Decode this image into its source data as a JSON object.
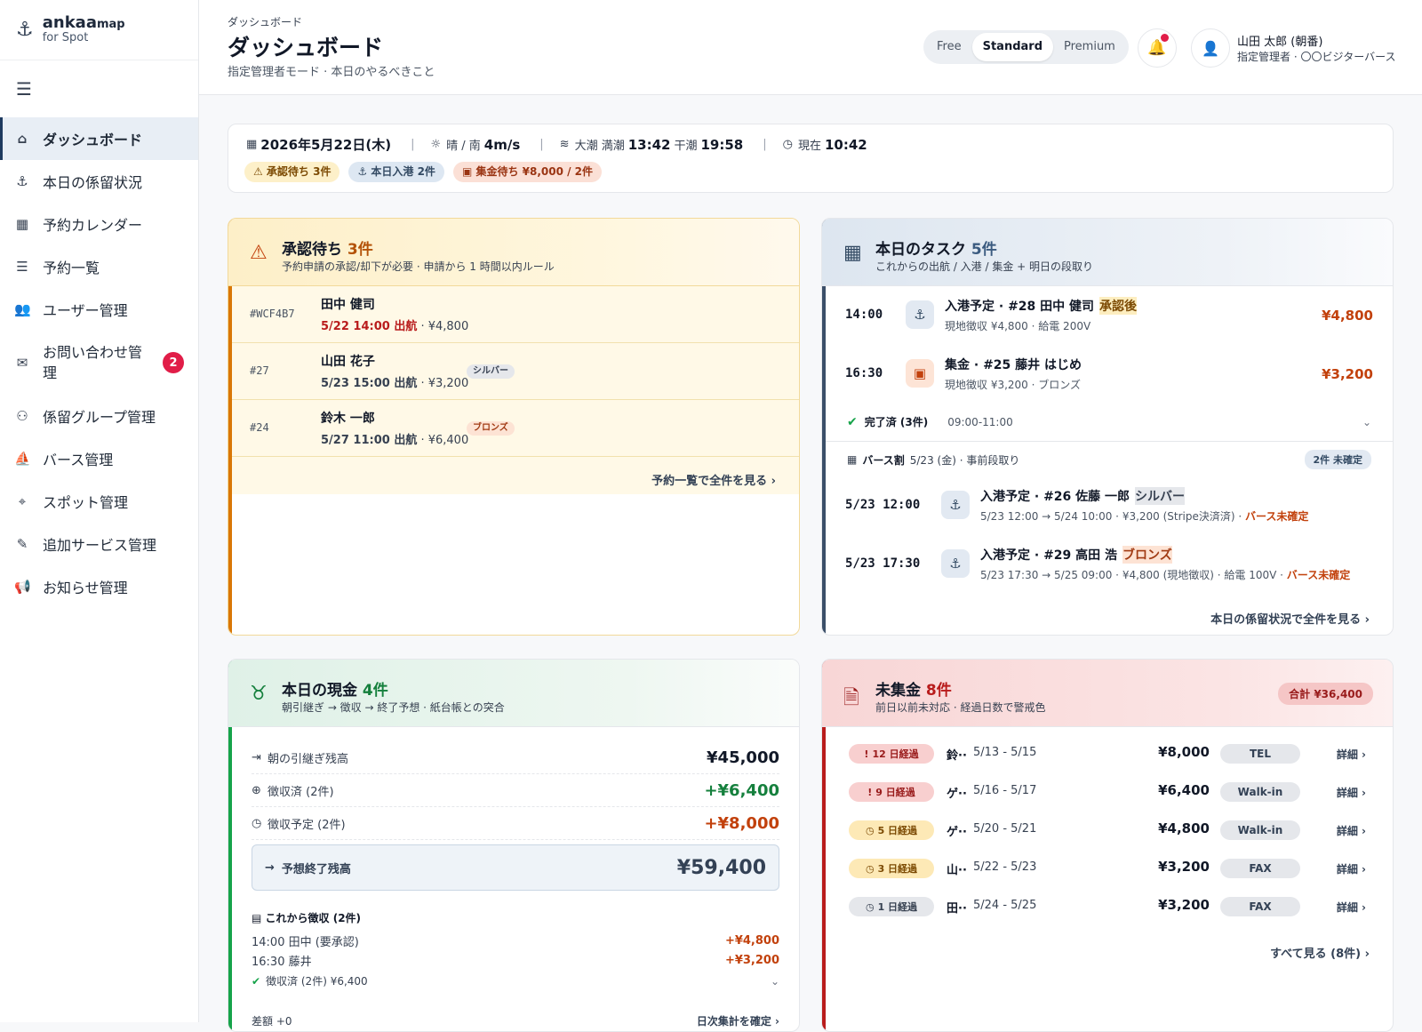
{
  "brand": {
    "name": "ankaa",
    "suffix": "map",
    "sub": "for Spot"
  },
  "nav": [
    {
      "label": "ダッシュボード",
      "icon": "home-icon",
      "glyph": "⌂",
      "active": true
    },
    {
      "label": "本日の係留状況",
      "icon": "anchor-icon",
      "glyph": "⚓"
    },
    {
      "label": "予約カレンダー",
      "icon": "calendar-icon",
      "glyph": "▦"
    },
    {
      "label": "予約一覧",
      "icon": "list-icon",
      "glyph": "☰"
    },
    {
      "label": "ユーザー管理",
      "icon": "users-icon",
      "glyph": "👥"
    },
    {
      "label": "お問い合わせ管理",
      "icon": "chat-icon",
      "glyph": "✉",
      "badge": "2"
    },
    {
      "label": "係留グループ管理",
      "icon": "group-icon",
      "glyph": "⚇"
    },
    {
      "label": "バース管理",
      "icon": "boat-icon",
      "glyph": "⛵"
    },
    {
      "label": "スポット管理",
      "icon": "pin-icon",
      "glyph": "⌖"
    },
    {
      "label": "追加サービス管理",
      "icon": "service-icon",
      "glyph": "✎"
    },
    {
      "label": "お知らせ管理",
      "icon": "megaphone-icon",
      "glyph": "📢"
    }
  ],
  "header": {
    "breadcrumb": "ダッシュボード",
    "title": "ダッシュボード",
    "subtitle": "指定管理者モード · 本日のやるべきこと",
    "plans": [
      "Free",
      "Standard",
      "Premium"
    ],
    "active_plan": "Standard",
    "user_name": "山田 太郎 (朝番)",
    "user_role": "指定管理者 · 〇〇ビジターバース"
  },
  "info": {
    "date": "2026年5月22日(木)",
    "weather_label": "晴 / 南",
    "wind": "4m/s",
    "tide_label": "大潮 満潮",
    "high_tide": "13:42",
    "low_label": "干潮",
    "low_tide": "19:58",
    "now_label": "現在",
    "now": "10:42",
    "chips": [
      "⚠ 承認待ち 3件",
      "⚓ 本日入港 2件",
      "▣ 集金待ち ¥8,000 / 2件"
    ]
  },
  "approvals": {
    "title": "承認待ち",
    "count": "3件",
    "subtitle": "予約申請の承認/却下が必要 · 申請から 1 時間以内ルール",
    "rows": [
      {
        "id": "#WCF4B7",
        "name": "田中 健司",
        "when": "5/22 14:00 出航",
        "price": " · ¥4,800",
        "tag": ""
      },
      {
        "id": "#27",
        "name": "山田 花子",
        "when": "5/23 15:00 出航",
        "price": " · ¥3,200",
        "tag": "シルバー"
      },
      {
        "id": "#24",
        "name": "鈴木 一郎",
        "when": "5/27 11:00 出航",
        "price": " · ¥6,400",
        "tag": "ブロンズ"
      }
    ],
    "more": "予約一覧で全件を見る ›"
  },
  "tasks": {
    "title": "本日のタスク",
    "count": "5件",
    "subtitle": "これからの出航 / 入港 / 集金 + 明日の段取り",
    "today": [
      {
        "time": "14:00",
        "title": "入港予定 · #28 田中 健司",
        "tag": "承認後",
        "detail": "現地徴収 ¥4,800 · 給電 200V",
        "amount": "¥4,800"
      },
      {
        "time": "16:30",
        "title": "集金 · #25 藤井 はじめ",
        "tag": "",
        "detail": "現地徴収 ¥3,200 · ブロンズ",
        "amount": "¥3,200"
      }
    ],
    "done_label": "完了済 (3件)",
    "done_time": "09:00-11:00",
    "berth_label": "バース割",
    "berth_detail": "5/23 (金) · 事前段取り",
    "berth_pill": "2件 未確定",
    "tomorrow": [
      {
        "time": "5/23 12:00",
        "title": "入港予定 · #26 佐藤 一郎",
        "tag": "シルバー",
        "detail": "5/23 12:00 → 5/24 10:00 · ¥3,200 (Stripe決済済) · ",
        "warn": "バース未確定"
      },
      {
        "time": "5/23 17:30",
        "title": "入港予定 · #29 高田 浩",
        "tag": "ブロンズ",
        "detail": "5/23 17:30 → 5/25 09:00 · ¥4,800 (現地徴収) · 給電 100V · ",
        "warn": "バース未確定"
      }
    ],
    "more": "本日の係留状況で全件を見る ›"
  },
  "cash": {
    "title": "本日の現金",
    "count": "4件",
    "subtitle": "朝引継ぎ → 徴収 → 終了予想 · 紙台帳との突合",
    "rows": [
      {
        "label": "朝の引継ぎ残高",
        "value": "¥45,000"
      },
      {
        "label": "徴収済 (2件)",
        "value": "+¥6,400"
      },
      {
        "label": "徴収予定 (2件)",
        "value": "+¥8,000"
      }
    ],
    "forecast_label": "予想終了残高",
    "forecast_value": "¥59,400",
    "collect_title": "これから徴収 (2件)",
    "collect": [
      {
        "label": "14:00 田中 (要承認)",
        "value": "+¥4,800"
      },
      {
        "label": "16:30 藤井",
        "value": "+¥3,200"
      }
    ],
    "collected": "徴収済 (2件) ¥6,400",
    "diff": "差額 +0",
    "confirm": "日次集計を確定 ›"
  },
  "unpaid": {
    "title": "未集金",
    "count": "8件",
    "subtitle": "前日以前未対応 · 経過日数で警戒色",
    "total": "合計 ¥36,400",
    "rows": [
      {
        "days": "12 日経過",
        "glyph": "!",
        "level": "hot",
        "name": "鈴··",
        "period": "5/13 - 5/15",
        "amount": "¥8,000",
        "channel": "TEL"
      },
      {
        "days": "9 日経過",
        "glyph": "!",
        "level": "hot",
        "name": "ゲ··",
        "period": "5/16 - 5/17",
        "amount": "¥6,400",
        "channel": "Walk-in"
      },
      {
        "days": "5 日経過",
        "glyph": "◷",
        "level": "mid",
        "name": "ゲ··",
        "period": "5/20 - 5/21",
        "amount": "¥4,800",
        "channel": "Walk-in"
      },
      {
        "days": "3 日経過",
        "glyph": "◷",
        "level": "mid",
        "name": "山··",
        "period": "5/22 - 5/23",
        "amount": "¥3,200",
        "channel": "FAX"
      },
      {
        "days": "1 日経過",
        "glyph": "◷",
        "level": "low",
        "name": "田··",
        "period": "5/24 - 5/25",
        "amount": "¥3,200",
        "channel": "FAX"
      }
    ],
    "detail_label": "詳細 ›",
    "more": "すべて見る (8件) ›"
  }
}
